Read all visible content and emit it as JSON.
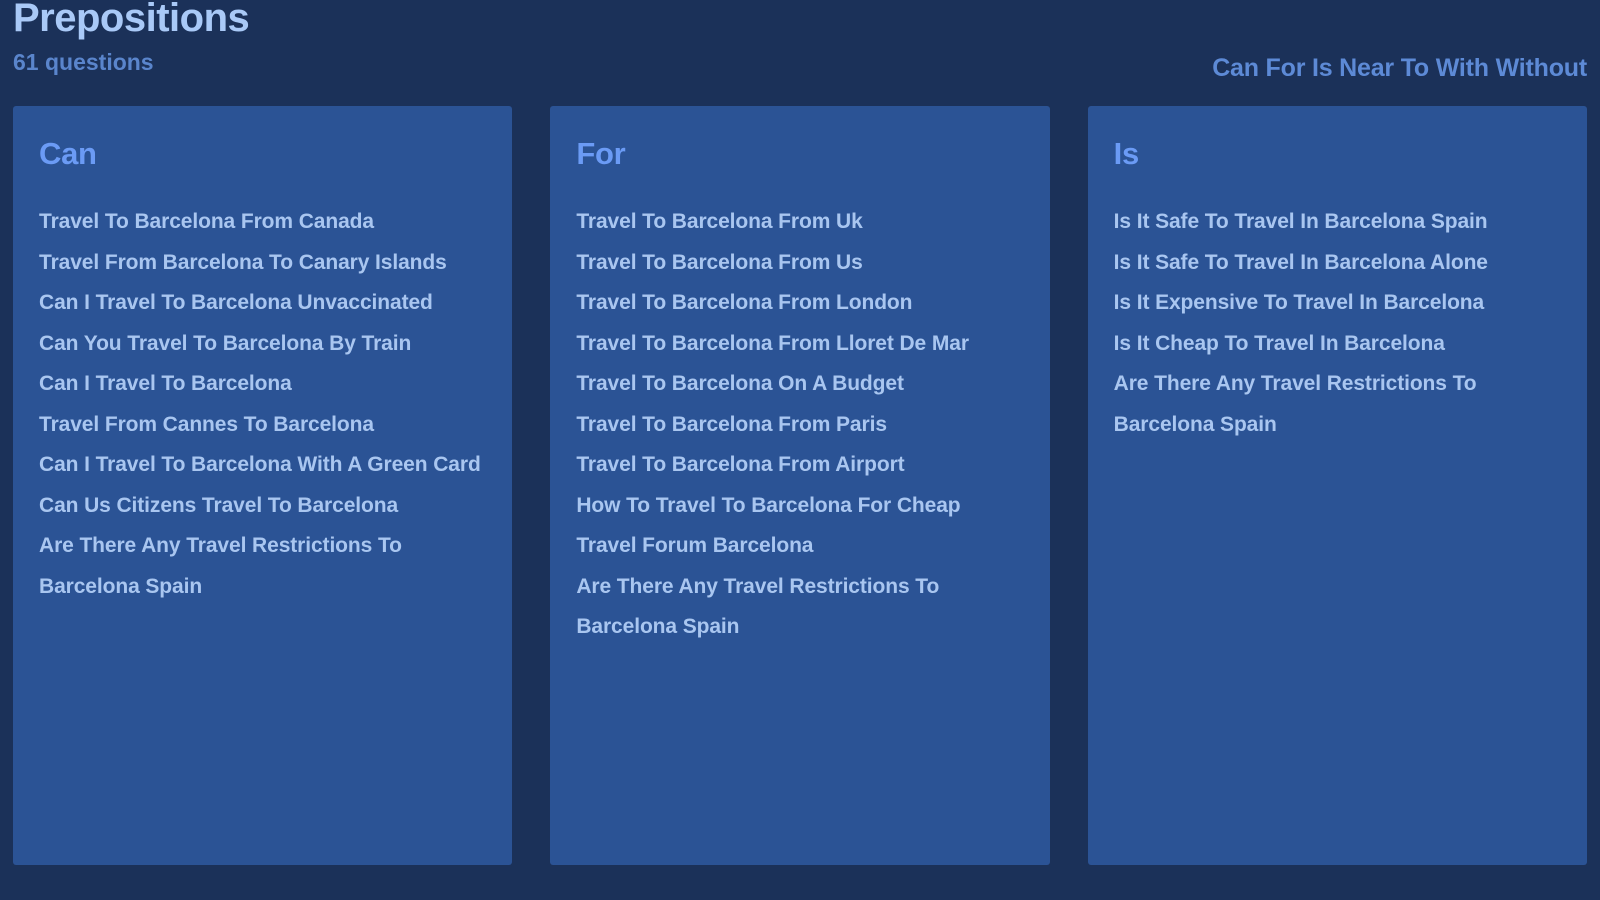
{
  "header": {
    "title": "Prepositions",
    "question_count": "61 questions",
    "categories": "Can For Is Near To With Without",
    "colors": {
      "background": "#1b3159",
      "card": "#2b5395",
      "title": "#a9c9f7",
      "subtitle": "#5a85cc",
      "column_title": "#6b9bf5",
      "item_text": "#a9c6f0"
    }
  },
  "columns": [
    {
      "title": "Can",
      "items": [
        "Travel To Barcelona From Canada",
        "Travel From Barcelona To Canary Islands",
        "Can I Travel To Barcelona Unvaccinated",
        "Can You Travel To Barcelona By Train",
        "Can I Travel To Barcelona",
        "Travel From Cannes To Barcelona",
        "Can I Travel To Barcelona With A Green Card",
        "Can Us Citizens Travel To Barcelona",
        "Are There Any Travel Restrictions To Barcelona Spain"
      ]
    },
    {
      "title": "For",
      "items": [
        "Travel To Barcelona From Uk",
        "Travel To Barcelona From Us",
        "Travel To Barcelona From London",
        "Travel To Barcelona From Lloret De Mar",
        "Travel To Barcelona On A Budget",
        "Travel To Barcelona From Paris",
        "Travel To Barcelona From Airport",
        "How To Travel To Barcelona For Cheap",
        "Travel Forum Barcelona",
        "Are There Any Travel Restrictions To Barcelona Spain"
      ]
    },
    {
      "title": "Is",
      "items": [
        "Is It Safe To Travel In Barcelona Spain",
        "Is It Safe To Travel In Barcelona Alone",
        "Is It Expensive To Travel In Barcelona",
        "Is It Cheap To Travel In Barcelona",
        "Are There Any Travel Restrictions To Barcelona Spain"
      ]
    }
  ]
}
